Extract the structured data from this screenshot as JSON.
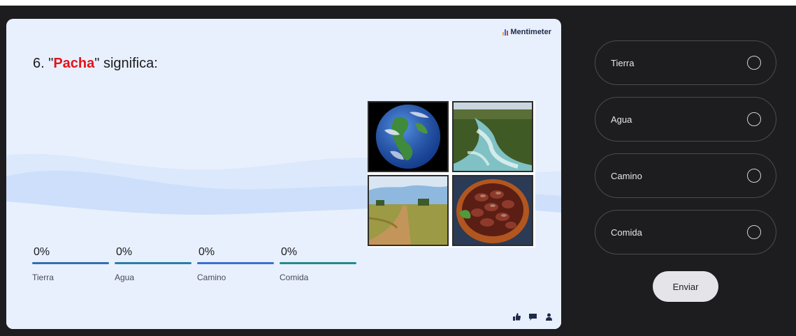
{
  "brand": {
    "name": "Mentimeter",
    "icon": "mentimeter-logo-icon"
  },
  "question": {
    "prefix": "6. \"",
    "keyword": "Pacha",
    "suffix": "\" significa:",
    "keyword_color": "#e0151b"
  },
  "images": [
    {
      "name": "earth-globe-image"
    },
    {
      "name": "river-water-image"
    },
    {
      "name": "dirt-road-image"
    },
    {
      "name": "beans-bowl-image"
    }
  ],
  "results": [
    {
      "percent": "0%",
      "label": "Tierra",
      "value": 0,
      "color": "#2f6fb0"
    },
    {
      "percent": "0%",
      "label": "Agua",
      "value": 0,
      "color": "#2a7fa6"
    },
    {
      "percent": "0%",
      "label": "Camino",
      "value": 0,
      "color": "#3b6fd0"
    },
    {
      "percent": "0%",
      "label": "Comida",
      "value": 0,
      "color": "#238a8f"
    }
  ],
  "reactions": [
    "thumbs-up-icon",
    "speech-bubble-icon",
    "person-icon"
  ],
  "options": [
    {
      "label": "Tierra",
      "selected": false
    },
    {
      "label": "Agua",
      "selected": false
    },
    {
      "label": "Camino",
      "selected": false
    },
    {
      "label": "Comida",
      "selected": false
    }
  ],
  "submit": {
    "label": "Enviar"
  },
  "colors": {
    "slide_bg": "#e8f0fd",
    "panel_bg": "#1d1d20",
    "wave": "#cddffa"
  }
}
